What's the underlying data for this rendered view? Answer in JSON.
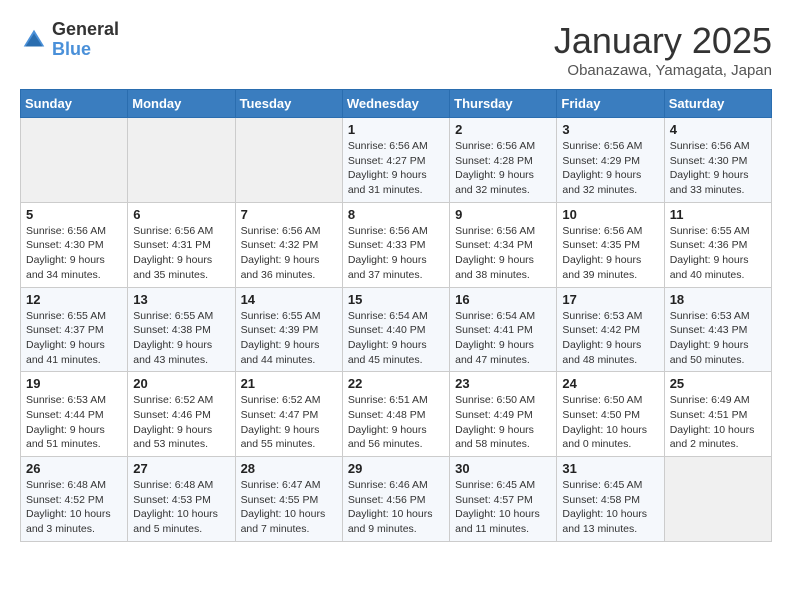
{
  "logo": {
    "general": "General",
    "blue": "Blue"
  },
  "title": "January 2025",
  "location": "Obanazawa, Yamagata, Japan",
  "weekdays": [
    "Sunday",
    "Monday",
    "Tuesday",
    "Wednesday",
    "Thursday",
    "Friday",
    "Saturday"
  ],
  "weeks": [
    [
      {
        "day": "",
        "info": ""
      },
      {
        "day": "",
        "info": ""
      },
      {
        "day": "",
        "info": ""
      },
      {
        "day": "1",
        "info": "Sunrise: 6:56 AM\nSunset: 4:27 PM\nDaylight: 9 hours and 31 minutes."
      },
      {
        "day": "2",
        "info": "Sunrise: 6:56 AM\nSunset: 4:28 PM\nDaylight: 9 hours and 32 minutes."
      },
      {
        "day": "3",
        "info": "Sunrise: 6:56 AM\nSunset: 4:29 PM\nDaylight: 9 hours and 32 minutes."
      },
      {
        "day": "4",
        "info": "Sunrise: 6:56 AM\nSunset: 4:30 PM\nDaylight: 9 hours and 33 minutes."
      }
    ],
    [
      {
        "day": "5",
        "info": "Sunrise: 6:56 AM\nSunset: 4:30 PM\nDaylight: 9 hours and 34 minutes."
      },
      {
        "day": "6",
        "info": "Sunrise: 6:56 AM\nSunset: 4:31 PM\nDaylight: 9 hours and 35 minutes."
      },
      {
        "day": "7",
        "info": "Sunrise: 6:56 AM\nSunset: 4:32 PM\nDaylight: 9 hours and 36 minutes."
      },
      {
        "day": "8",
        "info": "Sunrise: 6:56 AM\nSunset: 4:33 PM\nDaylight: 9 hours and 37 minutes."
      },
      {
        "day": "9",
        "info": "Sunrise: 6:56 AM\nSunset: 4:34 PM\nDaylight: 9 hours and 38 minutes."
      },
      {
        "day": "10",
        "info": "Sunrise: 6:56 AM\nSunset: 4:35 PM\nDaylight: 9 hours and 39 minutes."
      },
      {
        "day": "11",
        "info": "Sunrise: 6:55 AM\nSunset: 4:36 PM\nDaylight: 9 hours and 40 minutes."
      }
    ],
    [
      {
        "day": "12",
        "info": "Sunrise: 6:55 AM\nSunset: 4:37 PM\nDaylight: 9 hours and 41 minutes."
      },
      {
        "day": "13",
        "info": "Sunrise: 6:55 AM\nSunset: 4:38 PM\nDaylight: 9 hours and 43 minutes."
      },
      {
        "day": "14",
        "info": "Sunrise: 6:55 AM\nSunset: 4:39 PM\nDaylight: 9 hours and 44 minutes."
      },
      {
        "day": "15",
        "info": "Sunrise: 6:54 AM\nSunset: 4:40 PM\nDaylight: 9 hours and 45 minutes."
      },
      {
        "day": "16",
        "info": "Sunrise: 6:54 AM\nSunset: 4:41 PM\nDaylight: 9 hours and 47 minutes."
      },
      {
        "day": "17",
        "info": "Sunrise: 6:53 AM\nSunset: 4:42 PM\nDaylight: 9 hours and 48 minutes."
      },
      {
        "day": "18",
        "info": "Sunrise: 6:53 AM\nSunset: 4:43 PM\nDaylight: 9 hours and 50 minutes."
      }
    ],
    [
      {
        "day": "19",
        "info": "Sunrise: 6:53 AM\nSunset: 4:44 PM\nDaylight: 9 hours and 51 minutes."
      },
      {
        "day": "20",
        "info": "Sunrise: 6:52 AM\nSunset: 4:46 PM\nDaylight: 9 hours and 53 minutes."
      },
      {
        "day": "21",
        "info": "Sunrise: 6:52 AM\nSunset: 4:47 PM\nDaylight: 9 hours and 55 minutes."
      },
      {
        "day": "22",
        "info": "Sunrise: 6:51 AM\nSunset: 4:48 PM\nDaylight: 9 hours and 56 minutes."
      },
      {
        "day": "23",
        "info": "Sunrise: 6:50 AM\nSunset: 4:49 PM\nDaylight: 9 hours and 58 minutes."
      },
      {
        "day": "24",
        "info": "Sunrise: 6:50 AM\nSunset: 4:50 PM\nDaylight: 10 hours and 0 minutes."
      },
      {
        "day": "25",
        "info": "Sunrise: 6:49 AM\nSunset: 4:51 PM\nDaylight: 10 hours and 2 minutes."
      }
    ],
    [
      {
        "day": "26",
        "info": "Sunrise: 6:48 AM\nSunset: 4:52 PM\nDaylight: 10 hours and 3 minutes."
      },
      {
        "day": "27",
        "info": "Sunrise: 6:48 AM\nSunset: 4:53 PM\nDaylight: 10 hours and 5 minutes."
      },
      {
        "day": "28",
        "info": "Sunrise: 6:47 AM\nSunset: 4:55 PM\nDaylight: 10 hours and 7 minutes."
      },
      {
        "day": "29",
        "info": "Sunrise: 6:46 AM\nSunset: 4:56 PM\nDaylight: 10 hours and 9 minutes."
      },
      {
        "day": "30",
        "info": "Sunrise: 6:45 AM\nSunset: 4:57 PM\nDaylight: 10 hours and 11 minutes."
      },
      {
        "day": "31",
        "info": "Sunrise: 6:45 AM\nSunset: 4:58 PM\nDaylight: 10 hours and 13 minutes."
      },
      {
        "day": "",
        "info": ""
      }
    ]
  ]
}
